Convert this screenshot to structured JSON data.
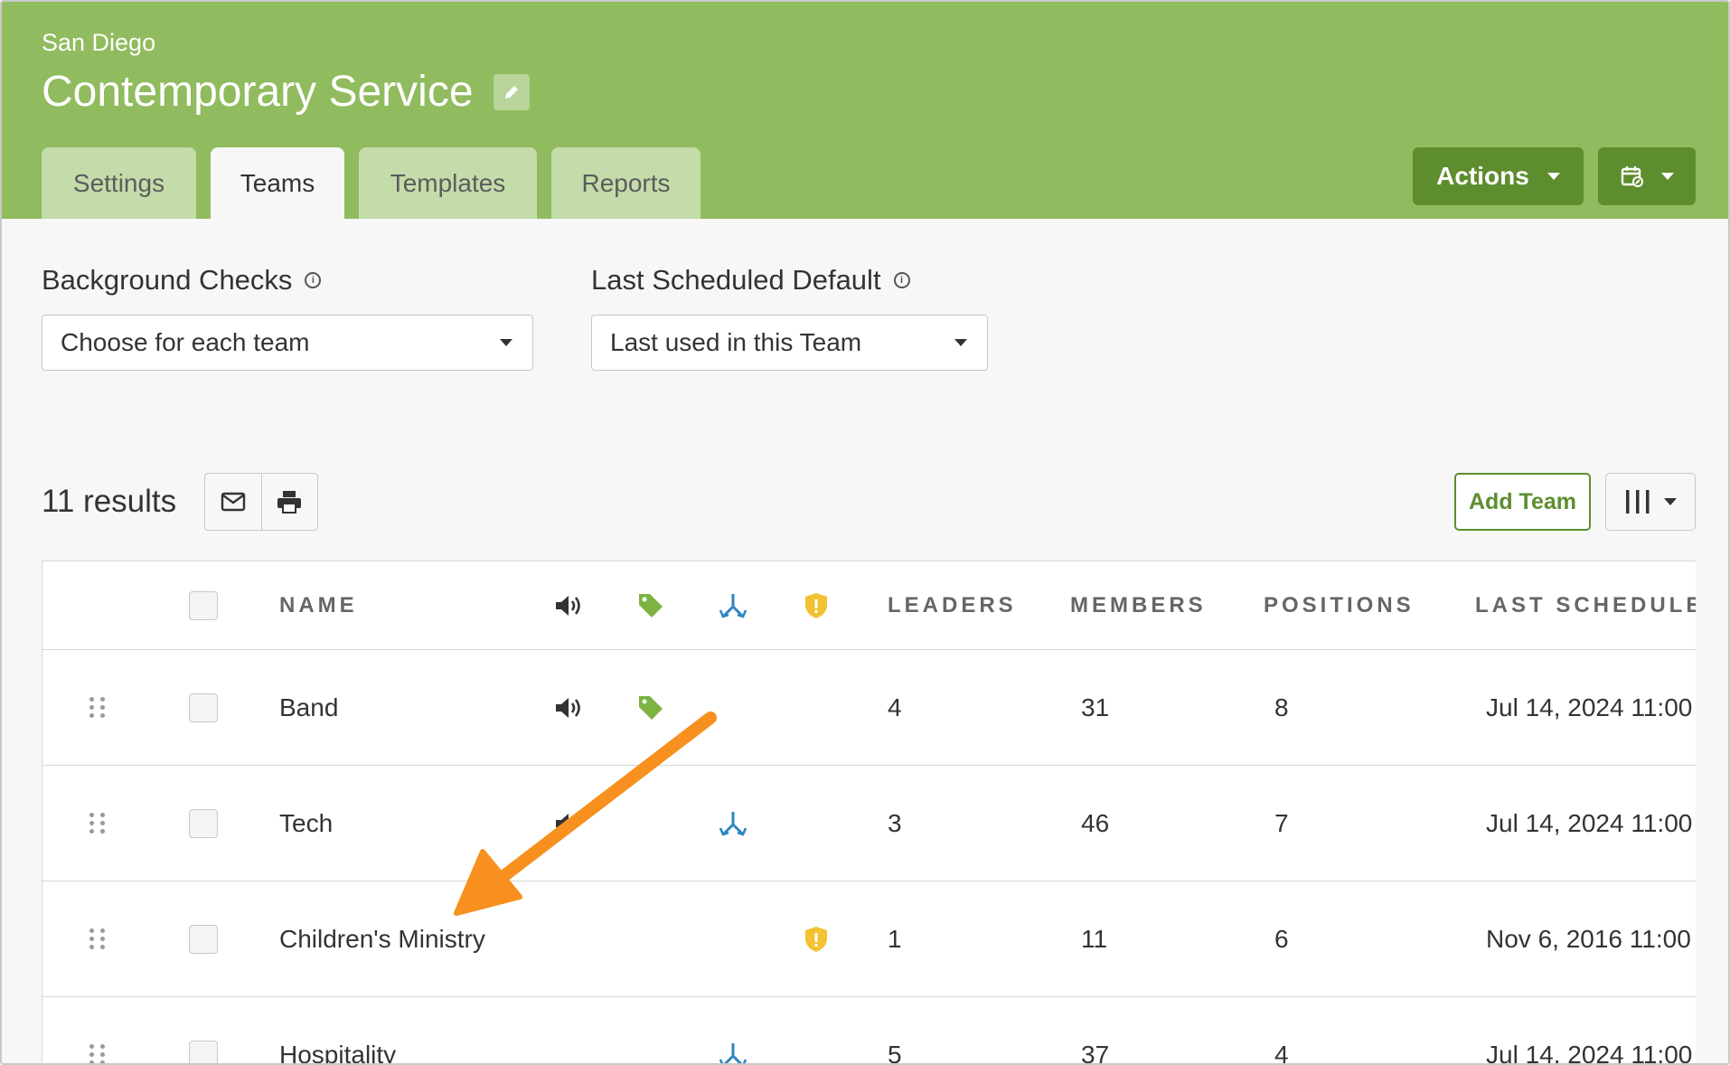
{
  "header": {
    "campus": "San Diego",
    "title": "Contemporary Service",
    "edit_icon": "pencil-icon",
    "tabs": [
      {
        "label": "Settings",
        "active": false
      },
      {
        "label": "Teams",
        "active": true
      },
      {
        "label": "Templates",
        "active": false
      },
      {
        "label": "Reports",
        "active": false
      }
    ],
    "actions_label": "Actions",
    "calendar_icon": "calendar-link-icon"
  },
  "filters": {
    "background_checks": {
      "label": "Background Checks",
      "value": "Choose for each team"
    },
    "last_scheduled_default": {
      "label": "Last Scheduled Default",
      "value": "Last used in this Team"
    }
  },
  "results": {
    "count_text": "11 results",
    "add_team_label": "Add Team"
  },
  "table": {
    "headers": {
      "name": "NAME",
      "leaders": "LEADERS",
      "members": "MEMBERS",
      "positions": "POSITIONS",
      "last_scheduled": "LAST SCHEDULE"
    },
    "rows": [
      {
        "name": "Band",
        "leaders": "4",
        "members": "31",
        "positions": "8",
        "last_scheduled": "Jul 14, 2024 11:00"
      },
      {
        "name": "Tech",
        "leaders": "3",
        "members": "46",
        "positions": "7",
        "last_scheduled": "Jul 14, 2024 11:00"
      },
      {
        "name": "Children's Ministry",
        "leaders": "1",
        "members": "11",
        "positions": "6",
        "last_scheduled": "Nov 6, 2016 11:00"
      },
      {
        "name": "Hospitality",
        "leaders": "5",
        "members": "37",
        "positions": "4",
        "last_scheduled": "Jul 14, 2024 11:00"
      }
    ]
  },
  "colors": {
    "header_green": "#90bb5e",
    "button_green": "#5e8d2e",
    "tag_green": "#7cb342",
    "split_blue": "#2e86c1",
    "shield_yellow": "#f2c230",
    "annotation_orange": "#f7901e"
  }
}
